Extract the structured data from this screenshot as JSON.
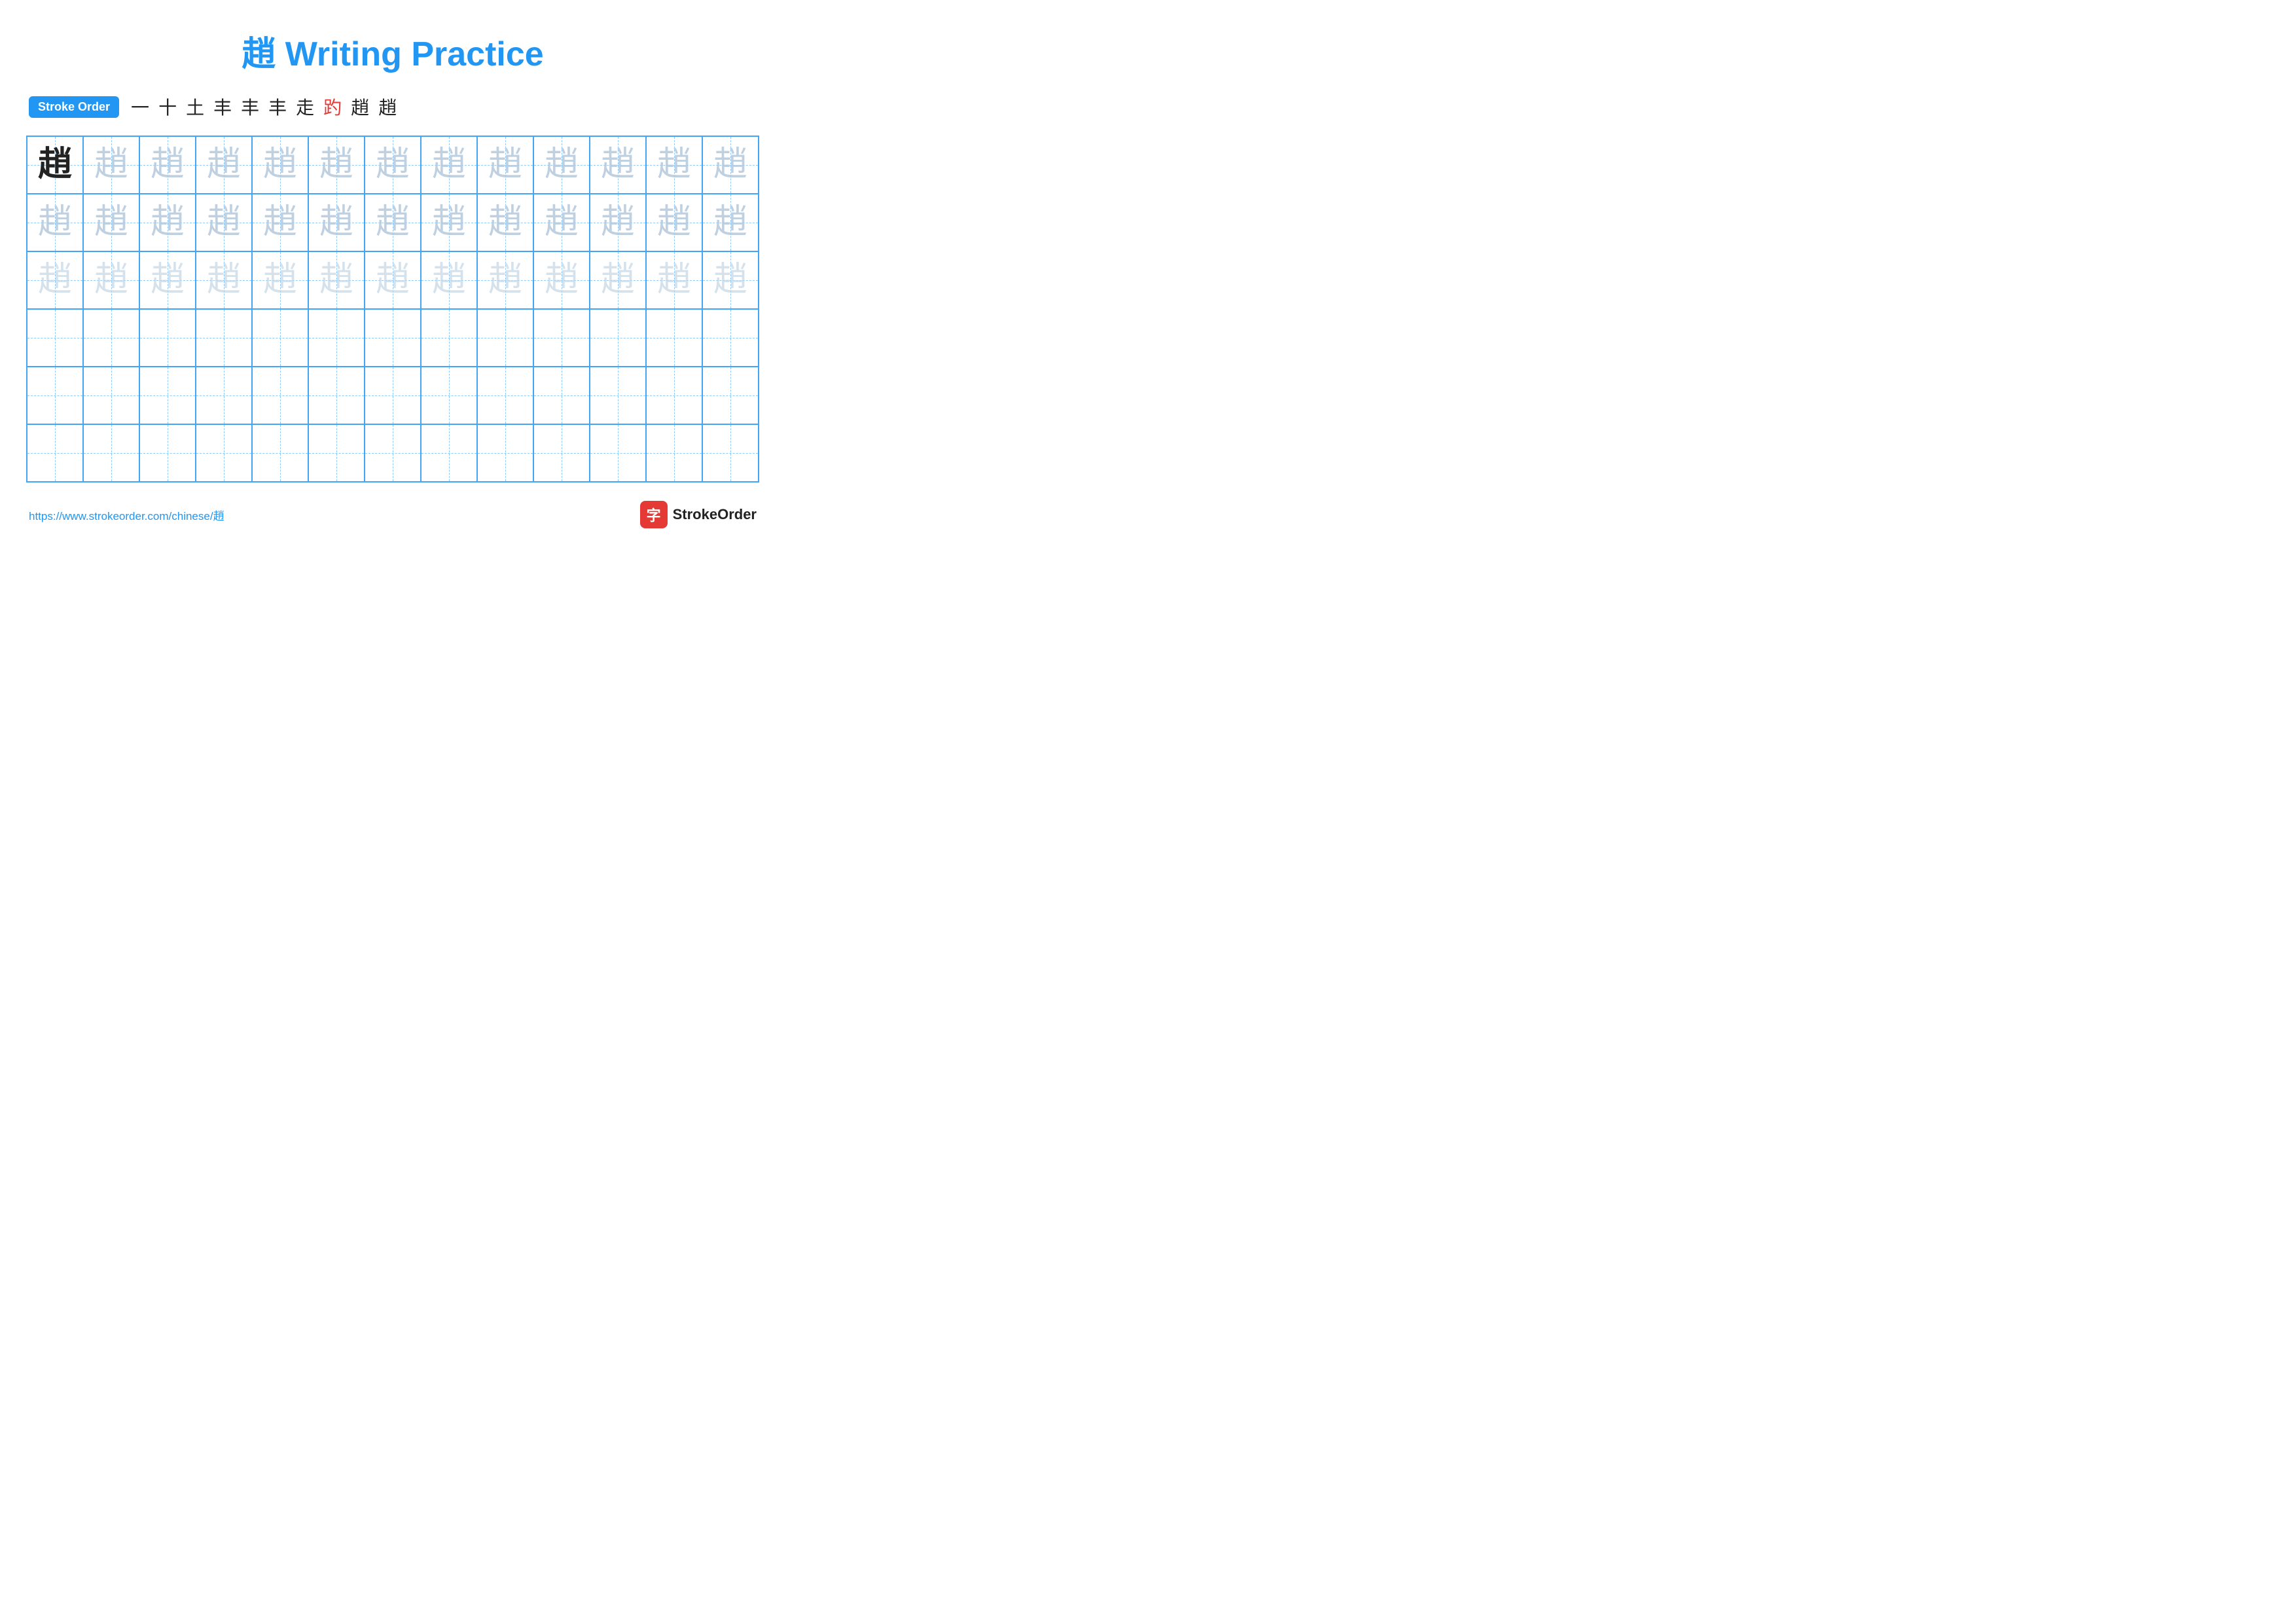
{
  "title": {
    "char": "趙",
    "text": " Writing Practice",
    "full": "趙 Writing Practice"
  },
  "stroke_order": {
    "badge": "Stroke Order",
    "strokes": [
      "一",
      "十",
      "土",
      "丰",
      "丰",
      "丰",
      "走",
      "趵",
      "趙",
      "趙"
    ]
  },
  "grid": {
    "rows": 6,
    "cols": 13,
    "char": "趙",
    "row_types": [
      "solid-then-light",
      "light",
      "lighter",
      "empty",
      "empty",
      "empty"
    ]
  },
  "footer": {
    "url": "https://www.strokeorder.com/chinese/趙",
    "logo_char": "字",
    "logo_text": "StrokeOrder"
  }
}
